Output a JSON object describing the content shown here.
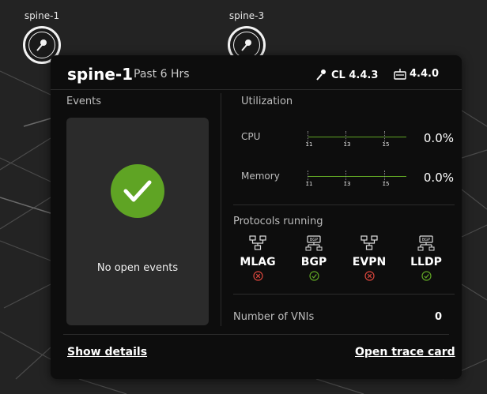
{
  "nodes": [
    {
      "label": "spine-1"
    },
    {
      "label": "spine-3"
    }
  ],
  "card": {
    "hostname": "spine-1",
    "period": "Past 6 Hrs",
    "os_version": "CL 4.4.3",
    "agent_version": "4.4.0",
    "events": {
      "title": "Events",
      "message": "No open events"
    },
    "utilization": {
      "title": "Utilization",
      "metrics": [
        {
          "label": "CPU",
          "value": "0.0%",
          "ticks": [
            "11",
            "13",
            "15"
          ]
        },
        {
          "label": "Memory",
          "value": "0.0%",
          "ticks": [
            "11",
            "13",
            "15"
          ]
        }
      ]
    },
    "protocols": {
      "title": "Protocols running",
      "items": [
        {
          "name": "MLAG",
          "status": "not-running"
        },
        {
          "name": "BGP",
          "status": "running"
        },
        {
          "name": "EVPN",
          "status": "not-running"
        },
        {
          "name": "LLDP",
          "status": "running"
        }
      ]
    },
    "vnis": {
      "label": "Number of VNIs",
      "value": "0"
    },
    "footer": {
      "show_details": "Show details",
      "open_trace": "Open trace card"
    }
  },
  "colors": {
    "ok": "#5fa424",
    "error": "#d9463c",
    "card_bg": "#0d0d0d",
    "panel_bg": "#2b2b2b"
  }
}
